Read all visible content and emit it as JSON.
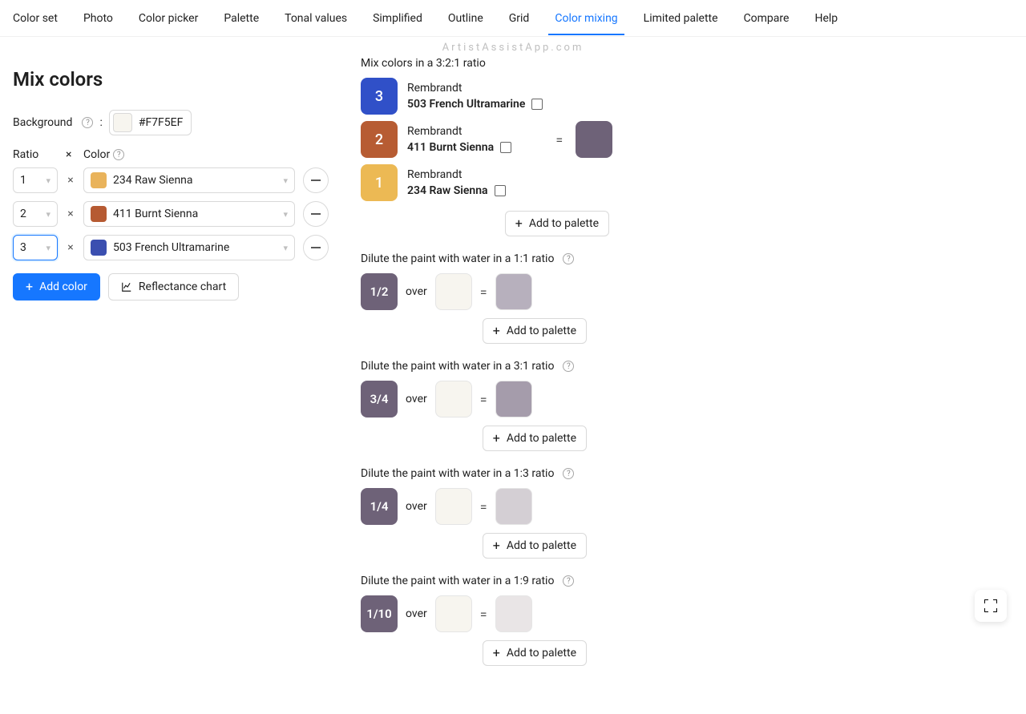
{
  "watermark": "ArtistAssistApp.com",
  "tabs": [
    "Color set",
    "Photo",
    "Color picker",
    "Palette",
    "Tonal values",
    "Simplified",
    "Outline",
    "Grid",
    "Color mixing",
    "Limited palette",
    "Compare",
    "Help"
  ],
  "active_tab": "Color mixing",
  "page_title": "Mix colors",
  "background": {
    "label": "Background",
    "hex": "#F7F5EF",
    "swatch": "#F7F5EF"
  },
  "ratio_header": "Ratio",
  "color_header": "Color",
  "times": "×",
  "mix_rows": [
    {
      "ratio": "1",
      "swatch": "#E9B35B",
      "name": "234 Raw Sienna",
      "focused": false
    },
    {
      "ratio": "2",
      "swatch": "#B65A32",
      "name": "411 Burnt Sienna",
      "focused": false
    },
    {
      "ratio": "3",
      "swatch": "#3B4FB0",
      "name": "503 French Ultramarine",
      "focused": true
    }
  ],
  "buttons": {
    "add_color": "Add color",
    "reflectance": "Reflectance chart",
    "add_palette": "Add to palette"
  },
  "mix_title": "Mix colors in a 3:2:1 ratio",
  "mix_parts": [
    {
      "badge": "3",
      "badge_color": "#3050C8",
      "brand": "Rembrandt",
      "name": "503 French Ultramarine"
    },
    {
      "badge": "2",
      "badge_color": "#B75C33",
      "brand": "Rembrandt",
      "name": "411 Burnt Sienna"
    },
    {
      "badge": "1",
      "badge_color": "#ECB954",
      "brand": "Rembrandt",
      "name": "234 Raw Sienna"
    }
  ],
  "equals": "=",
  "mix_result": "#6E6278",
  "over": "over",
  "dilutions": [
    {
      "title": "Dilute the paint with water in a 1:1 ratio",
      "badge": "1/2",
      "chip": "#6E6278",
      "result": "#B7B0BD"
    },
    {
      "title": "Dilute the paint with water in a 3:1 ratio",
      "badge": "3/4",
      "chip": "#6E6278",
      "result": "#A59CAB"
    },
    {
      "title": "Dilute the paint with water in a 1:3 ratio",
      "badge": "1/4",
      "chip": "#6E6278",
      "result": "#D4CFD4"
    },
    {
      "title": "Dilute the paint with water in a 1:9 ratio",
      "badge": "1/10",
      "chip": "#6E6278",
      "result": "#E9E5E6"
    }
  ]
}
